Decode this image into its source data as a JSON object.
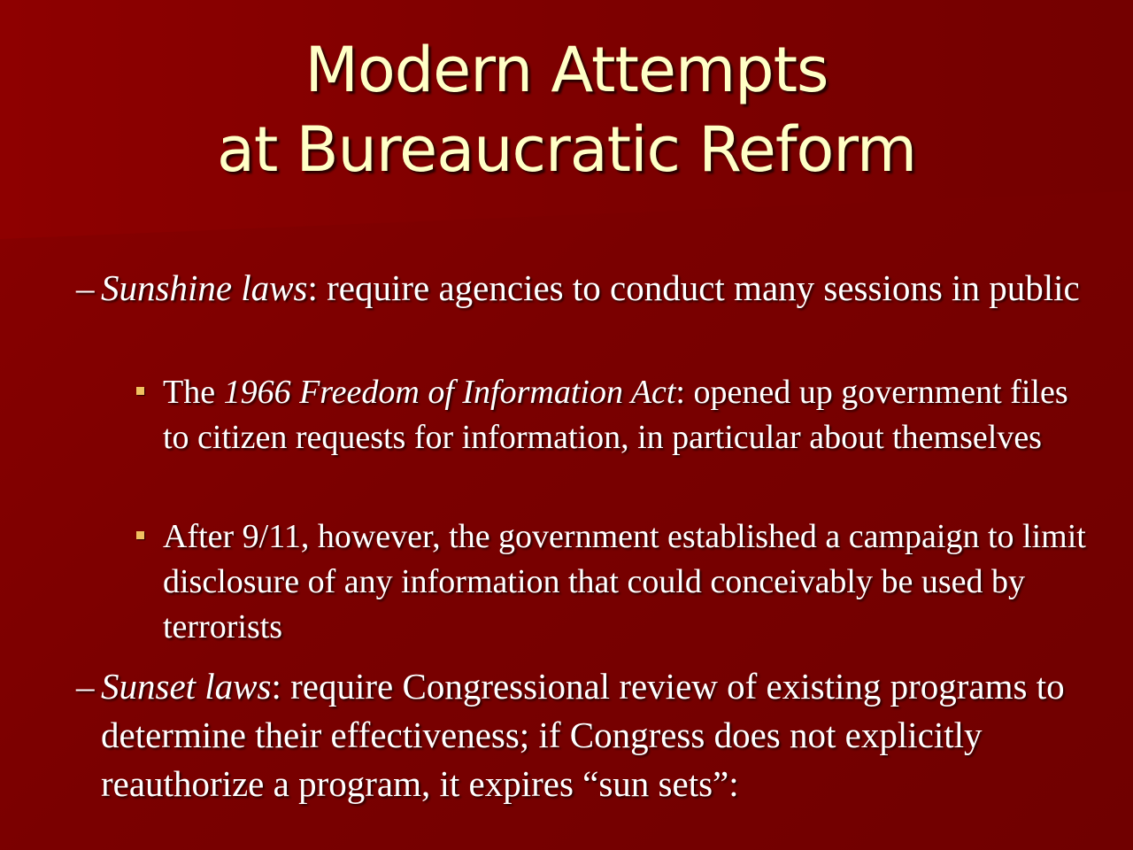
{
  "slide": {
    "title_line1": "Modern Attempts",
    "title_line2": "at Bureaucratic Reform",
    "items": [
      {
        "dash": "–",
        "term": "Sunshine laws",
        "rest": ":  require agencies to conduct many sessions in public"
      },
      {
        "pre": "The ",
        "term": "1966 Freedom of Information Act",
        "rest": ":  opened up government files to citizen requests for information, in particular about themselves"
      },
      {
        "text": "After 9/11, however, the government established a campaign to limit disclosure of any information that could conceivably be used by terrorists"
      },
      {
        "dash": "–",
        "term": "Sunset laws",
        "rest": ":  require Congressional review of existing programs to determine their effectiveness; if Congress does not explicitly reauthorize a program, it expires “sun sets”:"
      }
    ]
  },
  "colors": {
    "background": "#7b0000",
    "title": "#ffffc6",
    "body_text": "#ffffff",
    "bullet": "#f0c060"
  }
}
